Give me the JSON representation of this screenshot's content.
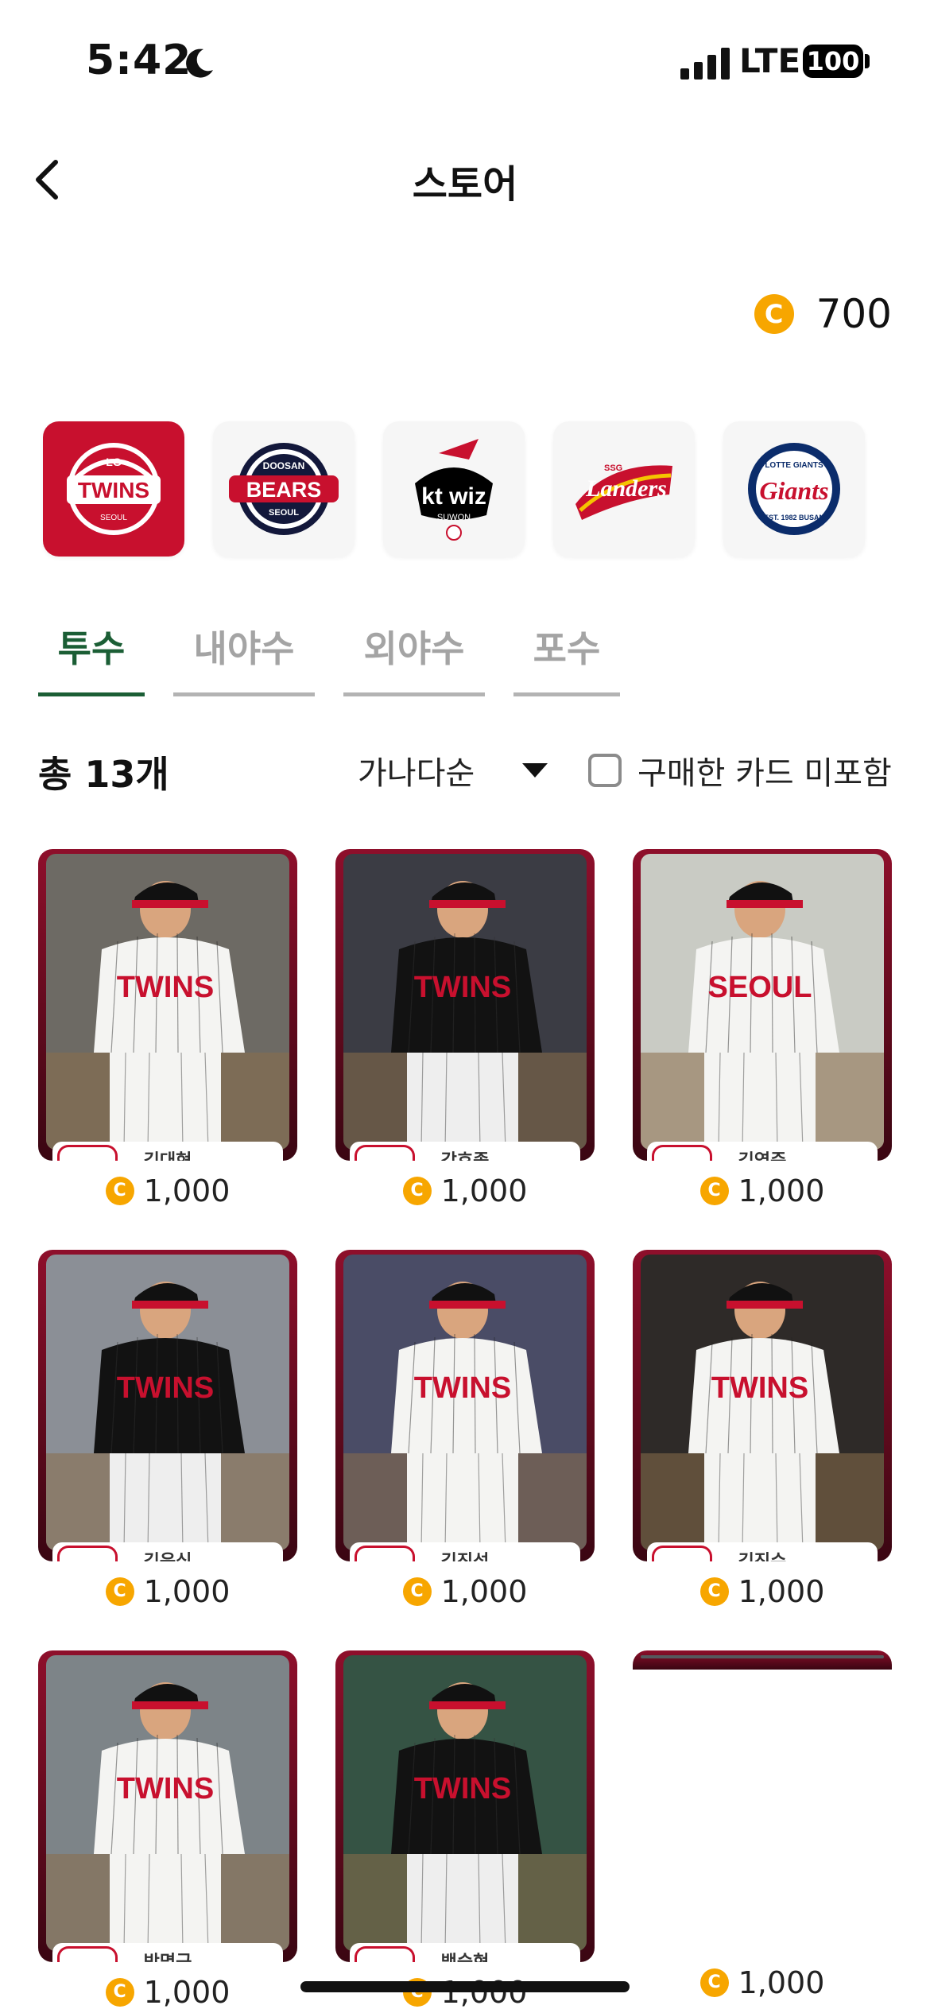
{
  "status_bar": {
    "time": "5:42",
    "network": "LTE",
    "battery": "100"
  },
  "nav": {
    "title": "스토어"
  },
  "wallet": {
    "coin_symbol": "C",
    "balance": "700"
  },
  "teams": [
    {
      "id": "lg",
      "name": "LG TWINS",
      "active": true
    },
    {
      "id": "doosan",
      "name": "DOOSAN BEARS",
      "active": false
    },
    {
      "id": "kt",
      "name": "kt wiz",
      "active": false
    },
    {
      "id": "ssg",
      "name": "SSG Landers",
      "active": false
    },
    {
      "id": "lotte",
      "name": "LOTTE Giants",
      "active": false
    }
  ],
  "tabs": [
    {
      "label": "투수",
      "active": true
    },
    {
      "label": "내야수",
      "active": false
    },
    {
      "label": "외야수",
      "active": false
    },
    {
      "label": "포수",
      "active": false
    }
  ],
  "filter": {
    "total": "총 13개",
    "sort_label": "가나다순",
    "exclude_label": "구매한 카드 미포함",
    "exclude_checked": false
  },
  "cards": [
    {
      "name": "김대현",
      "price": "1,000",
      "jersey": "white"
    },
    {
      "name": "강효종",
      "price": "1,000",
      "jersey": "black"
    },
    {
      "name": "김영준",
      "price": "1,000",
      "jersey": "seoul"
    },
    {
      "name": "김윤식",
      "price": "1,000",
      "jersey": "black"
    },
    {
      "name": "김진성",
      "price": "1,000",
      "jersey": "white"
    },
    {
      "name": "김진수",
      "price": "1,000",
      "jersey": "white"
    },
    {
      "name": "박명근",
      "price": "1,000",
      "jersey": "white"
    },
    {
      "name": "백승현",
      "price": "1,000",
      "jersey": "black"
    },
    {
      "name": "",
      "price": "1,000",
      "jersey": "none"
    }
  ],
  "colors": {
    "accent_green": "#1b5e35",
    "lg_red": "#c8102e",
    "coin": "#f7a600"
  }
}
